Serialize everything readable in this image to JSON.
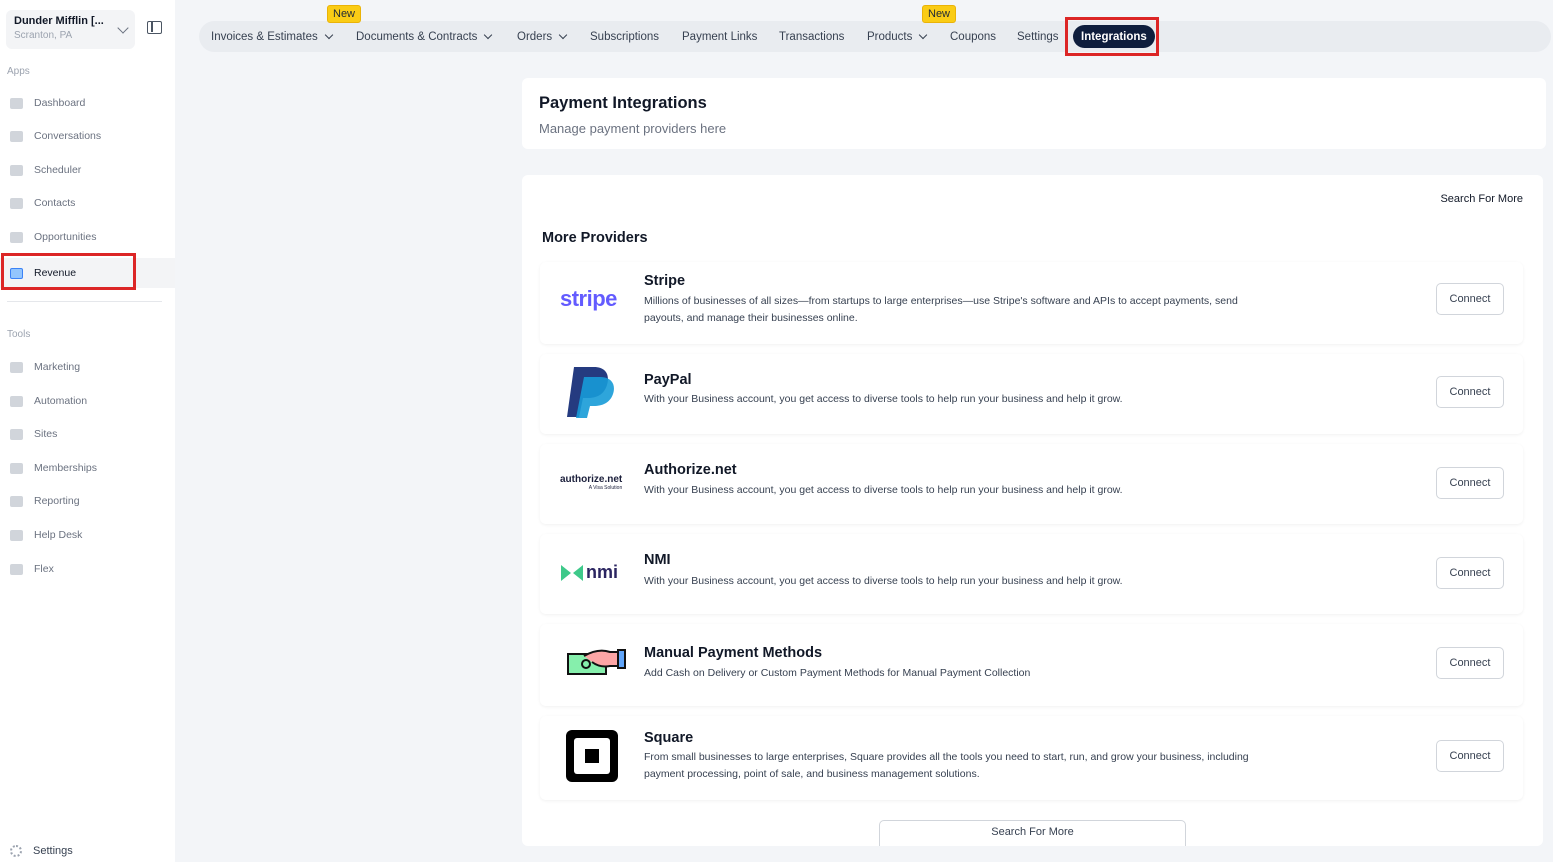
{
  "account": {
    "name": "Dunder Mifflin [...",
    "location": "Scranton, PA"
  },
  "sidebar": {
    "apps_label": "Apps",
    "apps": [
      {
        "label": "Dashboard",
        "icon": "dashboard-icon"
      },
      {
        "label": "Conversations",
        "icon": "chat-icon"
      },
      {
        "label": "Scheduler",
        "icon": "calendar-icon"
      },
      {
        "label": "Contacts",
        "icon": "person-icon"
      },
      {
        "label": "Opportunities",
        "icon": "target-icon"
      },
      {
        "label": "Revenue",
        "icon": "credit-card-icon",
        "active": true
      }
    ],
    "tools_label": "Tools",
    "tools": [
      {
        "label": "Marketing",
        "icon": "megaphone-icon"
      },
      {
        "label": "Automation",
        "icon": "gears-icon"
      },
      {
        "label": "Sites",
        "icon": "globe-icon"
      },
      {
        "label": "Memberships",
        "icon": "group-icon"
      },
      {
        "label": "Reporting",
        "icon": "pie-chart-icon"
      },
      {
        "label": "Help Desk",
        "icon": "help-icon"
      },
      {
        "label": "Flex",
        "icon": "team-icon"
      }
    ],
    "settings_label": "Settings"
  },
  "topnav": {
    "new_badge": "New",
    "tabs": [
      {
        "label": "Invoices & Estimates",
        "dropdown": true
      },
      {
        "label": "Documents & Contracts",
        "dropdown": true
      },
      {
        "label": "Orders",
        "dropdown": true
      },
      {
        "label": "Subscriptions"
      },
      {
        "label": "Payment Links"
      },
      {
        "label": "Transactions"
      },
      {
        "label": "Products",
        "dropdown": true
      },
      {
        "label": "Coupons"
      },
      {
        "label": "Settings"
      },
      {
        "label": "Integrations",
        "active": true
      }
    ]
  },
  "header": {
    "title": "Payment Integrations",
    "subtitle": "Manage payment providers here"
  },
  "providers_section": {
    "search_more_link": "Search For More",
    "title": "More Providers",
    "connect_label": "Connect",
    "search_more_button": "Search For More",
    "providers": [
      {
        "name": "Stripe",
        "description": "Millions of businesses of all sizes—from startups to large enterprises—use Stripe's software and APIs to accept payments, send payouts, and manage their businesses online.",
        "logo_text": "stripe"
      },
      {
        "name": "PayPal",
        "description": "With your Business account, you get access to diverse tools to help run your business and help it grow.",
        "logo_text": ""
      },
      {
        "name": "Authorize.net",
        "description": "With your Business account, you get access to diverse tools to help run your business and help it grow.",
        "logo_text": "authorize.net",
        "logo_sub": "A Visa Solution"
      },
      {
        "name": "NMI",
        "description": "With your Business account, you get access to diverse tools to help run your business and help it grow.",
        "logo_text": "nmi"
      },
      {
        "name": "Manual Payment Methods",
        "description": "Add Cash on Delivery or Custom Payment Methods for Manual Payment Collection",
        "logo_text": ""
      },
      {
        "name": "Square",
        "description": "From small businesses to large enterprises, Square provides all the tools you need to start, run, and grow your business, including payment processing, point of sale, and business management solutions.",
        "logo_text": ""
      }
    ]
  },
  "colors": {
    "active_tab": "#0f1e3d",
    "badge": "#facc15",
    "highlight": "#dc2626",
    "stripe": "#635bff"
  }
}
